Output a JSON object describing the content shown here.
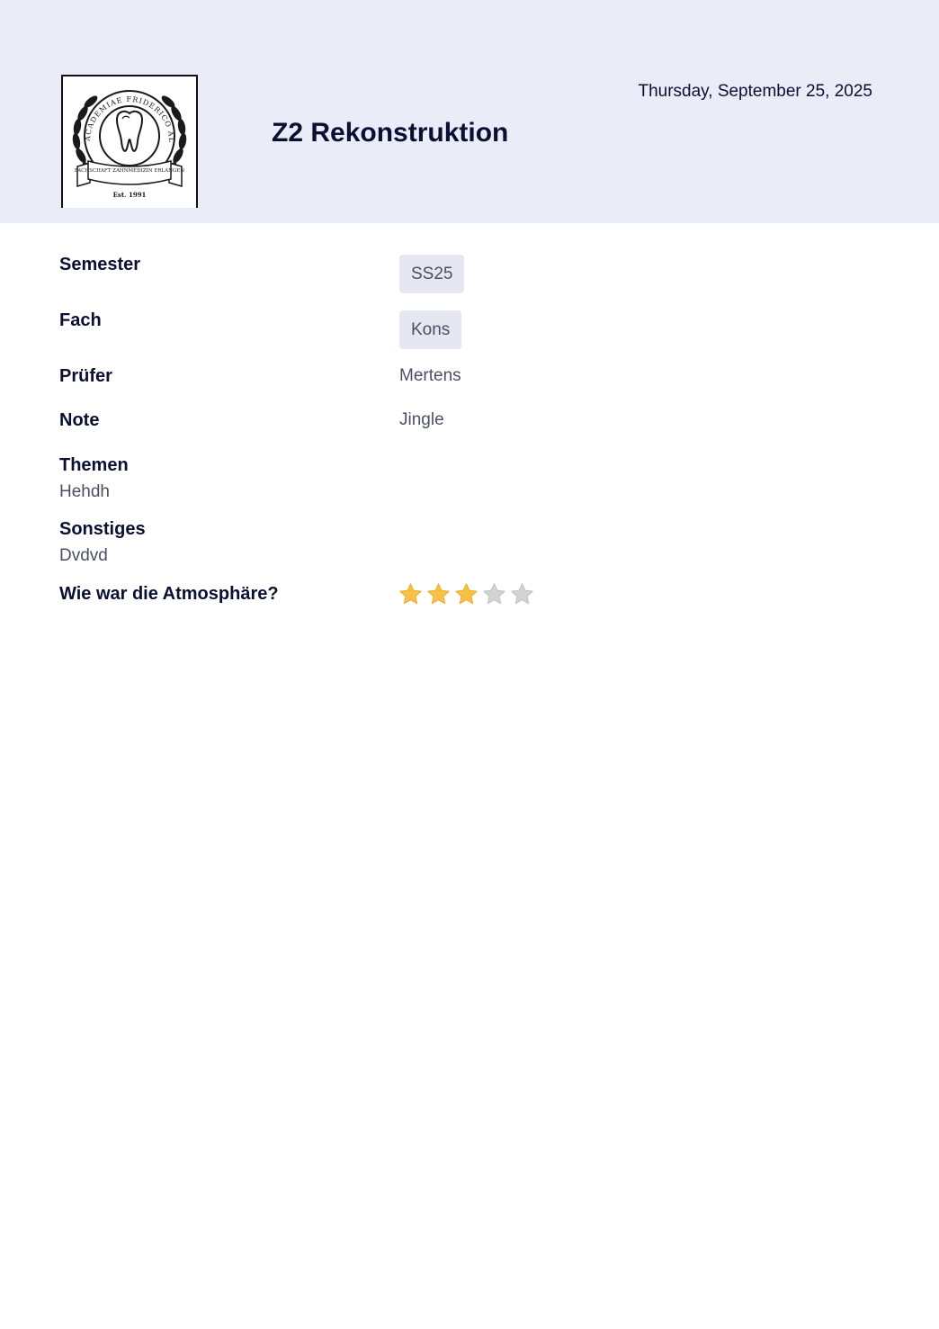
{
  "header": {
    "title": "Z2 Rekonstruktion",
    "date": "Thursday, September 25, 2025",
    "logo": {
      "icon": "tooth-seal-logo",
      "text_top": "ACADEMIAE FRIDERICO ALEXANDRINAE",
      "text_banner": "FACHSCHAFT ZAHNMEDIZIN ERLANGEN",
      "text_est": "Est. 1991"
    }
  },
  "fields": {
    "semester": {
      "label": "Semester",
      "value": "SS25"
    },
    "fach": {
      "label": "Fach",
      "value": "Kons"
    },
    "pruefer": {
      "label": "Prüfer",
      "value": "Mertens"
    },
    "note": {
      "label": "Note",
      "value": "Jingle"
    },
    "themen": {
      "label": "Themen",
      "value": "Hehdh"
    },
    "sonstiges": {
      "label": "Sonstiges",
      "value": "Dvdvd"
    },
    "atmosphaere": {
      "label": "Wie war die Atmosphäre?",
      "rating": 3,
      "max": 5
    }
  },
  "colors": {
    "header_bg": "#eaecf8",
    "star_filled": "#f7c046",
    "star_empty": "#d3d3d3",
    "label_text": "#0b1033",
    "value_text": "#4a5063"
  }
}
